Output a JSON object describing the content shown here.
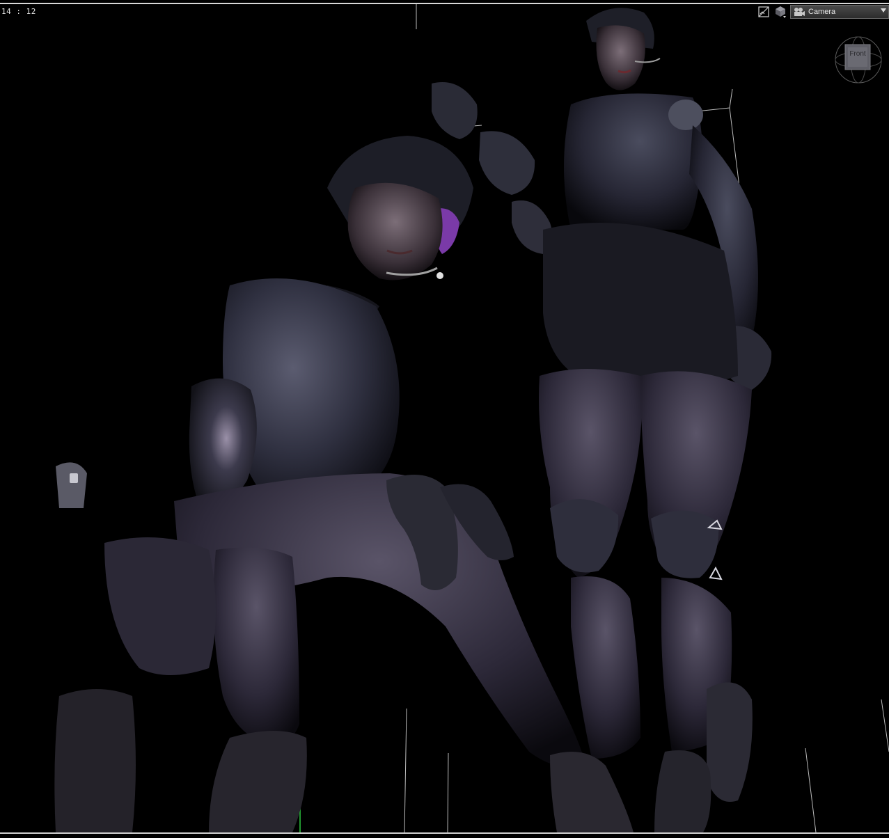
{
  "viewport": {
    "aspect_readout": "14 : 12",
    "camera_label": "Camera",
    "view_cube_face": "Front",
    "icons": {
      "render_toggle": "render-preview-icon",
      "draw_style": "cube-draw-style-icon",
      "camera": "camera-icon",
      "dropdown": "chevron-down-icon"
    },
    "colors": {
      "background": "#000000",
      "frame": "#d8d8d8",
      "figure_base": "#23232e",
      "figure_highlight": "#5a5a6e",
      "accent_hair": "#7a3aa8"
    }
  }
}
